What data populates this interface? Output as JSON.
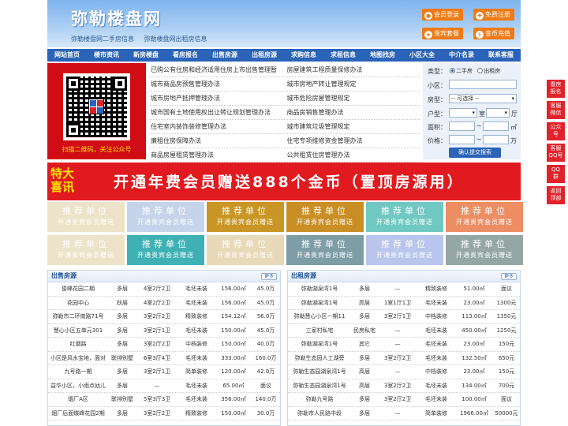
{
  "header": {
    "logo": "弥勒楼盘网",
    "sub_links": [
      "弥勒楼盘网二手房信息",
      "弥勒楼盘网出租房信息"
    ],
    "buttons": [
      {
        "label": "会员登录",
        "icon": "user-icon"
      },
      {
        "label": "免费注册",
        "icon": "register-icon"
      },
      {
        "label": "贵宾套餐",
        "icon": "vip-icon"
      },
      {
        "label": "金币充值",
        "icon": "coin-icon"
      }
    ]
  },
  "nav": [
    "网站首页",
    "楼市资讯",
    "新房楼盘",
    "看房报名",
    "出售房源",
    "出租房源",
    "求购信息",
    "求租信息",
    "地图找房",
    "小区大全",
    "中介名录",
    "联系客服"
  ],
  "qr": {
    "caption": "扫描二维码，关注公众号"
  },
  "links": [
    [
      "已购公有住房和经济适用住房上市出售管理暂",
      "房屋建筑工程质量保修办法"
    ],
    [
      "城市商品房预售管理办法",
      "城市房地产转让管理规定"
    ],
    [
      "城市房地产抵押管理办法",
      "城市危险房屋管理规定"
    ],
    [
      "城市国有土地使用权出让转让规划管理办法",
      "商品房销售管理办法"
    ],
    [
      "住宅室内装饰装修管理办法",
      "城市建筑垃圾管理规定"
    ],
    [
      "廉租住房保障办法",
      "住宅专项维修资金管理办法"
    ],
    [
      "商品房屋租赁管理办法",
      "公共租赁住房管理办法"
    ]
  ],
  "search": {
    "type_label": "类型：",
    "type_options": [
      "二手房",
      "出租房"
    ],
    "community_label": "小区：",
    "house_label": "房型：",
    "house_value": "-- 可选择 --",
    "layout_label": "户型：",
    "room_unit": "室",
    "hall_unit": "厅",
    "area_label": "面积：",
    "price_label": "价格：",
    "range_sep": "~",
    "area_unit": "㎡",
    "price_unit": "万",
    "submit": "确认提交搜索"
  },
  "side_buttons": [
    "看房\n报名",
    "客服\n微信",
    "公众\n号",
    "客服\nQQ号",
    "QQ\n群",
    "返回\n顶部"
  ],
  "banner": {
    "tag": "特大\n喜讯",
    "text": "开通年费会员赠送888个金币（置顶房源用）"
  },
  "tiles": {
    "title": "推荐单位",
    "subtitle": "开通贵宾会员赠送",
    "colors": [
      "#ede3c8",
      "#c5d4ea",
      "#c99625",
      "#c98f25",
      "#6fc8c1",
      "#ec8d63",
      "#ede3c8",
      "#3fb1b5",
      "#e8d9b8",
      "#7e9da6",
      "#b9c5ec",
      "#95a7a5"
    ]
  },
  "sale": {
    "title": "出售房源",
    "more": "更多",
    "rows": [
      [
        "俊峰花园二期",
        "多层",
        "4室2厅2卫",
        "毛坯未装",
        "156.00㎡",
        "45.0万"
      ],
      [
        "花园中心",
        "跃层",
        "4室2厅2卫",
        "毛坯未装",
        "156.00㎡",
        "45.0万"
      ],
      [
        "弥勒市二环南路71号",
        "多层",
        "3室2厅2卫",
        "精致装修",
        "154.12㎡",
        "56.0万"
      ],
      [
        "慧心小区五单元301",
        "多层",
        "3室2厅1卫",
        "毛坯未装",
        "150.00㎡",
        "45.0万"
      ],
      [
        "红烟路",
        "多层",
        "3室2厅2卫",
        "中档装修",
        "150.00㎡",
        "40.0万"
      ],
      [
        "小区是风水宝地，面对",
        "联排别墅",
        "6室3厅4卫",
        "毛坯未装",
        "333.00㎡",
        "160.0万"
      ],
      [
        "九号路一期",
        "多层",
        "3室2厅1卫",
        "简单装修",
        "120.00㎡",
        "42.0万"
      ],
      [
        "益华小区，小雨点幼儿",
        "多层",
        "—",
        "毛坯未装",
        "65.00㎡",
        "面议"
      ],
      [
        "烟厂A区",
        "联排别墅",
        "5室3厅3卫",
        "毛坯未装",
        "356.00㎡",
        "140.0万"
      ],
      [
        "烟厂后面蝶峰花园2期",
        "多层",
        "3室2厅2卫",
        "精致装修",
        "150.00㎡",
        "30.0万"
      ]
    ]
  },
  "rent": {
    "title": "出租房源",
    "more": "更多",
    "rows": [
      [
        "弥勒湖泉湾1号",
        "多层",
        "—",
        "精致装修",
        "51.00㎡",
        "面议"
      ],
      [
        "弥勒湖泉湾1号",
        "高层",
        "1室1厅1卫",
        "毛坯未装",
        "23.00㎡",
        "1300元"
      ],
      [
        "弥勒慧心小区一期11",
        "多层",
        "3室2厅1卫",
        "中档装修",
        "113.00㎡",
        "1350元"
      ],
      [
        "三家村私宅",
        "民房私宅",
        "—",
        "毛坯未装",
        "450.00㎡",
        "1250元"
      ],
      [
        "弥勒湖泉湾1号",
        "其它",
        "—",
        "毛坯未装",
        "23.00㎡",
        "150元"
      ],
      [
        "弥勒生态园人工湖旁",
        "多层",
        "3室2厅2卫",
        "毛坯未装",
        "132.50㎡",
        "650元"
      ],
      [
        "弥勒生态园湖泉湾1号",
        "高层",
        "—",
        "中档装修",
        "23.00㎡",
        "150元"
      ],
      [
        "弥勒生态园湖泉湾1号",
        "高层",
        "3室2厅2卫",
        "毛坯未装",
        "134.00㎡",
        "700元"
      ],
      [
        "弥勒九号路",
        "多层",
        "3室2厅2卫",
        "毛坯未装",
        "100.00㎡",
        "面议"
      ],
      [
        "弥勒市人民路中段",
        "多层",
        "—",
        "简单装修",
        "1966.00㎡",
        "50000元"
      ]
    ]
  }
}
